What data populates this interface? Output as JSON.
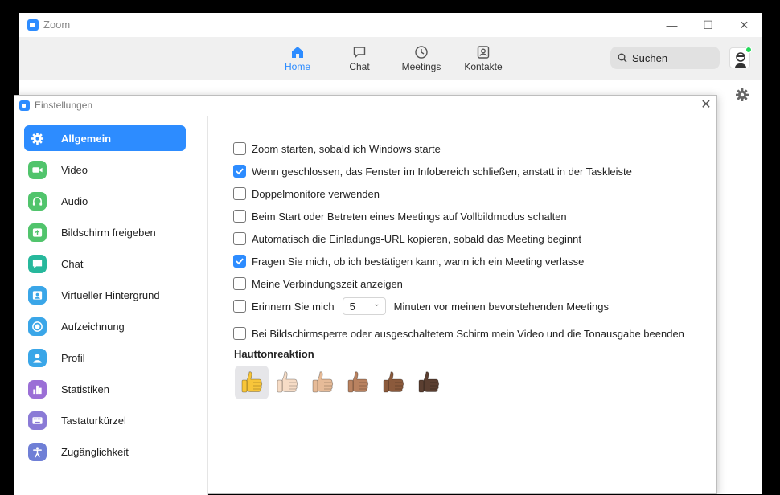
{
  "app": {
    "title": "Zoom",
    "window_controls": {
      "minimize": "—",
      "maximize": "☐",
      "close": "✕"
    }
  },
  "nav": {
    "tabs": [
      {
        "label": "Home",
        "icon": "home-icon",
        "active": true
      },
      {
        "label": "Chat",
        "icon": "chat-icon",
        "active": false
      },
      {
        "label": "Meetings",
        "icon": "clock-icon",
        "active": false
      },
      {
        "label": "Kontakte",
        "icon": "contacts-icon",
        "active": false
      }
    ],
    "search_placeholder": "Suchen"
  },
  "settings": {
    "title": "Einstellungen",
    "close": "✕",
    "sidebar": [
      {
        "label": "Allgemein",
        "icon": "gear-icon",
        "color": "#2d8cff",
        "active": true
      },
      {
        "label": "Video",
        "icon": "video-icon",
        "color": "#51c46c",
        "active": false
      },
      {
        "label": "Audio",
        "icon": "headphones-icon",
        "color": "#51c46c",
        "active": false
      },
      {
        "label": "Bildschirm freigeben",
        "icon": "share-screen-icon",
        "color": "#51c46c",
        "active": false
      },
      {
        "label": "Chat",
        "icon": "chat-bubble-icon",
        "color": "#27b89c",
        "active": false
      },
      {
        "label": "Virtueller Hintergrund",
        "icon": "virtual-background-icon",
        "color": "#3aa6e8",
        "active": false
      },
      {
        "label": "Aufzeichnung",
        "icon": "record-icon",
        "color": "#3aa6e8",
        "active": false
      },
      {
        "label": "Profil",
        "icon": "profile-icon",
        "color": "#3aa6e8",
        "active": false
      },
      {
        "label": "Statistiken",
        "icon": "statistics-icon",
        "color": "#9b6fd6",
        "active": false
      },
      {
        "label": "Tastaturkürzel",
        "icon": "keyboard-icon",
        "color": "#8a7ad6",
        "active": false
      },
      {
        "label": "Zugänglichkeit",
        "icon": "accessibility-icon",
        "color": "#6f7fd6",
        "active": false
      }
    ],
    "options": [
      {
        "label": "Zoom starten, sobald ich Windows starte",
        "checked": false
      },
      {
        "label": "Wenn geschlossen, das Fenster im Infobereich schließen, anstatt in der Taskleiste",
        "checked": true
      },
      {
        "label": "Doppelmonitore verwenden",
        "checked": false
      },
      {
        "label": "Beim Start oder Betreten eines Meetings auf Vollbildmodus schalten",
        "checked": false
      },
      {
        "label": "Automatisch die Einladungs-URL kopieren, sobald das Meeting beginnt",
        "checked": false
      },
      {
        "label": "Fragen Sie mich, ob ich bestätigen kann, wann ich ein Meeting verlasse",
        "checked": true
      },
      {
        "label": "Meine Verbindungszeit anzeigen",
        "checked": false
      }
    ],
    "remind": {
      "label_before": "Erinnern Sie mich",
      "minutes_value": "5",
      "label_after": "Minuten vor meinen bevorstehenden Meetings",
      "checked": false
    },
    "screen_lock": {
      "label": "Bei Bildschirmsperre oder ausgeschaltetem Schirm mein Video und die Tonausgabe beenden",
      "checked": false
    },
    "skin_tone": {
      "title": "Hauttonreaktion",
      "tones": [
        {
          "name": "default",
          "color": "#f7c53a",
          "selected": true
        },
        {
          "name": "light",
          "color": "#f6dcc6",
          "selected": false
        },
        {
          "name": "medium-light",
          "color": "#e6bb98",
          "selected": false
        },
        {
          "name": "medium",
          "color": "#b98260",
          "selected": false
        },
        {
          "name": "medium-dark",
          "color": "#8b5a3c",
          "selected": false
        },
        {
          "name": "dark",
          "color": "#5b3f31",
          "selected": false
        }
      ]
    }
  }
}
